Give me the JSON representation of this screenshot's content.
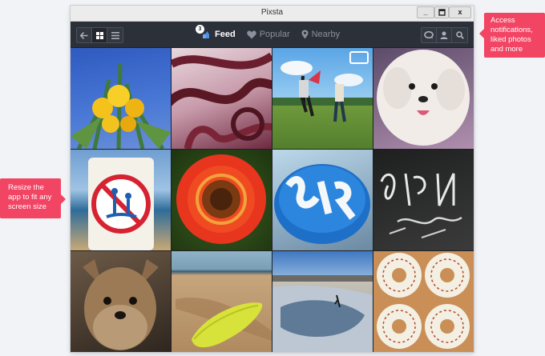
{
  "window": {
    "title": "Pixsta",
    "controls": {
      "minimize": "_",
      "maximize": "□",
      "close": "x"
    }
  },
  "toolbar": {
    "nav_buttons": [
      {
        "icon": "back-arrow-icon"
      },
      {
        "icon": "grid-view-icon",
        "active": true
      },
      {
        "icon": "list-view-icon"
      }
    ],
    "tabs": [
      {
        "label": "Feed",
        "icon": "feed-icon",
        "badge": "3",
        "active": true
      },
      {
        "label": "Popular",
        "icon": "heart-icon"
      },
      {
        "label": "Nearby",
        "icon": "location-pin-icon"
      }
    ],
    "right_buttons": [
      {
        "icon": "notifications-icon"
      },
      {
        "icon": "user-icon"
      },
      {
        "icon": "search-icon"
      }
    ]
  },
  "photos": [
    {
      "subject": "yellow flowers against blue sky"
    },
    {
      "subject": "curved red tubes"
    },
    {
      "subject": "two people jumping on grass"
    },
    {
      "subject": "white fluffy dog"
    },
    {
      "subject": "no swimming sign"
    },
    {
      "subject": "red sunflower"
    },
    {
      "subject": "blue cake with white lettering"
    },
    {
      "subject": "graffiti tag on black wall"
    },
    {
      "subject": "yorkshire terrier"
    },
    {
      "subject": "yellow surfboard on sand"
    },
    {
      "subject": "skate park bowl"
    },
    {
      "subject": "spitfire skateboard wheels"
    }
  ],
  "callouts": {
    "top_right": "Access notifications, liked photos and more",
    "left": "Resize the app to fit any screen size"
  },
  "colors": {
    "callout": "#f24463",
    "toolbar": "#2c3038",
    "background": "#f2f3f7"
  }
}
